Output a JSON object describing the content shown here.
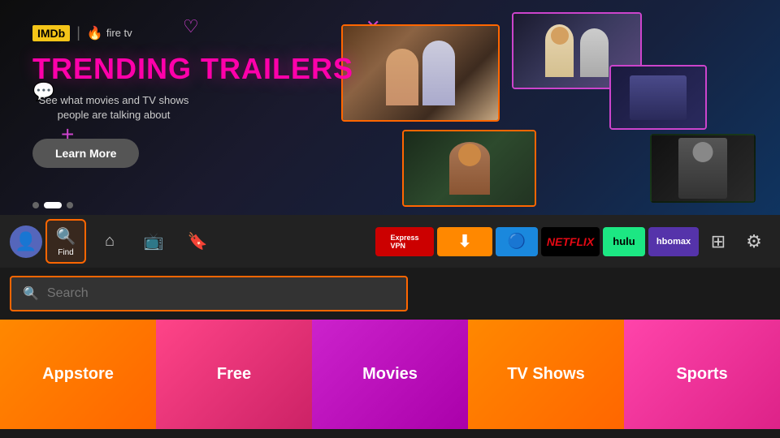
{
  "hero": {
    "logo": {
      "imdb": "IMDb",
      "separator": "|",
      "firetv": "fire tv"
    },
    "title": "TRENDING TRAILERS",
    "subtitle": "See what movies and TV shows people are talking about",
    "learn_more_label": "Learn More",
    "dots": [
      {
        "active": false
      },
      {
        "active": true
      },
      {
        "active": false
      }
    ]
  },
  "navbar": {
    "avatar_icon": "👤",
    "items": [
      {
        "id": "find",
        "icon": "🔍",
        "label": "Find",
        "active": true
      },
      {
        "id": "home",
        "icon": "⌂",
        "label": "",
        "active": false
      },
      {
        "id": "live",
        "icon": "📺",
        "label": "",
        "active": false
      },
      {
        "id": "bookmark",
        "icon": "🔖",
        "label": "",
        "active": false
      }
    ],
    "apps": [
      {
        "id": "expressvpn",
        "label": "ExpressVPN",
        "style": "expressvpn"
      },
      {
        "id": "downloader",
        "label": "⬇",
        "style": "downloader"
      },
      {
        "id": "blue-app",
        "label": "🔷",
        "style": "blue"
      },
      {
        "id": "netflix",
        "label": "NETFLIX",
        "style": "netflix"
      },
      {
        "id": "hulu",
        "label": "hulu",
        "style": "hulu"
      },
      {
        "id": "hbomax",
        "label": "hbomax",
        "style": "hbomax"
      }
    ],
    "grid_icon": "⊞",
    "settings_icon": "⚙"
  },
  "search": {
    "placeholder": "Search",
    "icon": "🔍"
  },
  "categories": [
    {
      "id": "appstore",
      "label": "Appstore",
      "color_class": "cat-appstore"
    },
    {
      "id": "free",
      "label": "Free",
      "color_class": "cat-free"
    },
    {
      "id": "movies",
      "label": "Movies",
      "color_class": "cat-movies"
    },
    {
      "id": "tvshows",
      "label": "TV Shows",
      "color_class": "cat-tvshows"
    },
    {
      "id": "sports",
      "label": "Sports",
      "color_class": "cat-sports"
    }
  ]
}
